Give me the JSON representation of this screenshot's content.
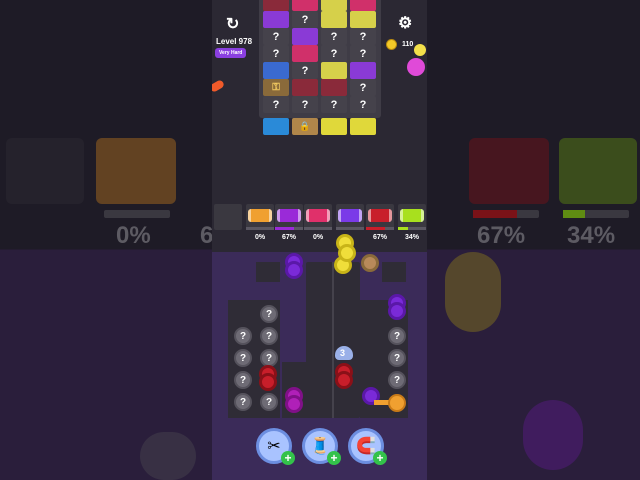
{
  "header": {
    "level_label": "Level 978",
    "difficulty_label": "Very Hard",
    "coins": "110"
  },
  "hidden_symbol": "?",
  "spools": [
    {
      "color": "#f0a030",
      "percent": "0%",
      "fill": 0
    },
    {
      "color": "#9a2ad8",
      "percent": "67%",
      "fill": 0.67
    },
    {
      "color": "#e0306a",
      "percent": "0%",
      "fill": 0
    },
    {
      "color": "#7a3ae8",
      "percent": "",
      "fill": 0
    },
    {
      "color": "#c81e2a",
      "percent": "67%",
      "fill": 0.67
    },
    {
      "color": "#a8e01e",
      "percent": "34%",
      "fill": 0.34
    }
  ],
  "stack_count": "3",
  "background_percents": {
    "left": "0%",
    "left_partial": "6",
    "right_a": "67%",
    "right_b": "34%"
  },
  "boosters": [
    {
      "name": "scissors",
      "icon": "✂",
      "plus": "+"
    },
    {
      "name": "thread-spool",
      "icon": "🧵",
      "plus": "+"
    },
    {
      "name": "magnet",
      "icon": "🧲",
      "plus": "+"
    }
  ]
}
